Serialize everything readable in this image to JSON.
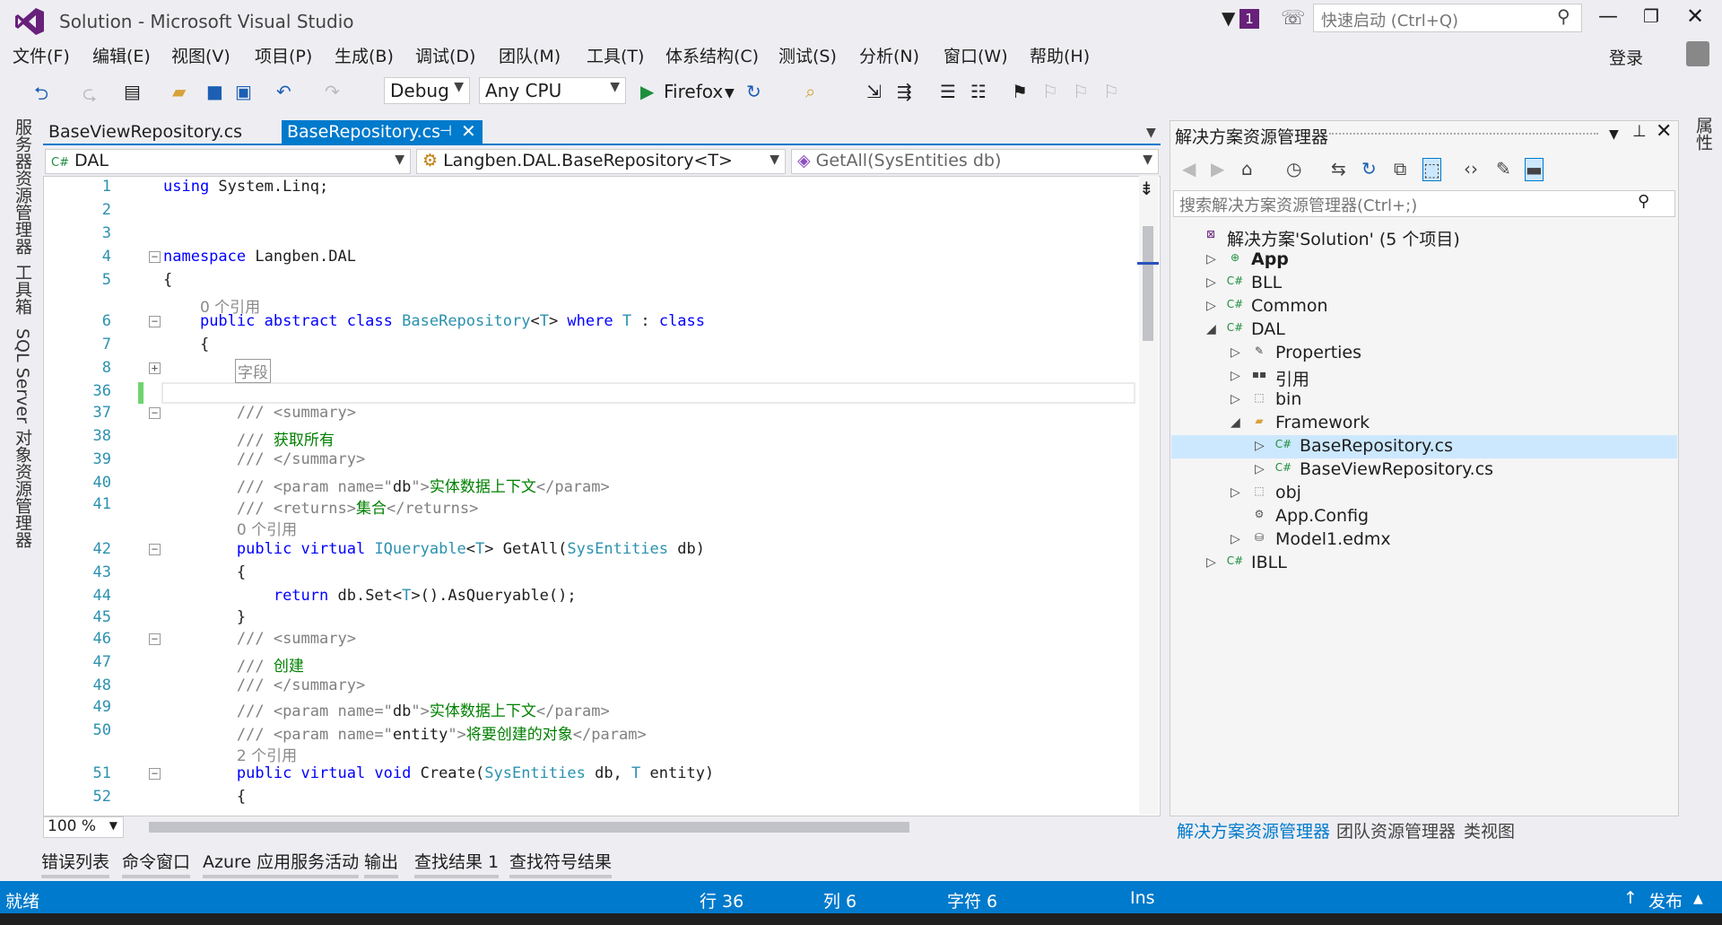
{
  "titlebar": {
    "title": "Solution - Microsoft Visual Studio",
    "notification_count": "1",
    "quick_launch_placeholder": "快速启动 (Ctrl+Q)"
  },
  "menu": [
    "文件(F)",
    "编辑(E)",
    "视图(V)",
    "项目(P)",
    "生成(B)",
    "调试(D)",
    "团队(M)",
    "工具(T)",
    "体系结构(C)",
    "测试(S)",
    "分析(N)",
    "窗口(W)",
    "帮助(H)"
  ],
  "signin": "登录",
  "toolbar": {
    "config": "Debug",
    "platform": "Any CPU",
    "run_target": "Firefox"
  },
  "left_vtabs": [
    "服务器资源管理器",
    "工具箱",
    "SQL Server 对象资源管理器"
  ],
  "doc_tabs": [
    {
      "label": "BaseViewRepository.cs"
    },
    {
      "label": "BaseRepository.cs"
    }
  ],
  "navbar": {
    "project": "DAL",
    "type": "Langben.DAL.BaseRepository<T>",
    "member": "GetAll(SysEntities db)"
  },
  "editor": {
    "zoom": "100 %",
    "collapsed_region": "字段",
    "lines": [
      {
        "n": "1",
        "html": "<span class='kw'>using</span> System.Linq;"
      },
      {
        "n": "2",
        "html": ""
      },
      {
        "n": "3",
        "html": ""
      },
      {
        "n": "4",
        "html": "<span class='kw'>namespace</span> Langben.DAL"
      },
      {
        "n": "5",
        "html": "{"
      },
      {
        "n": "",
        "html": "    <span class='ref'>0 个引用</span>"
      },
      {
        "n": "6",
        "html": "    <span class='kw'>public abstract class</span> <span class='ty'>BaseRepository</span>&lt;<span class='ty'>T</span>&gt; <span class='kw'>where</span> <span class='ty'>T</span> : <span class='kw'>class</span>"
      },
      {
        "n": "7",
        "html": "    {"
      },
      {
        "n": "8",
        "html": ""
      },
      {
        "n": "36",
        "html": ""
      },
      {
        "n": "37",
        "html": "        <span class='cg'>/// &lt;summary&gt;</span>"
      },
      {
        "n": "38",
        "html": "        <span class='cg'>///</span> <span class='cm'>获取所有</span>"
      },
      {
        "n": "39",
        "html": "        <span class='cg'>/// &lt;/summary&gt;</span>"
      },
      {
        "n": "40",
        "html": "        <span class='cg'>/// &lt;param name=\"</span>db<span class='cg'>\"&gt;</span><span class='cm'>实体数据上下文</span><span class='cg'>&lt;/param&gt;</span>"
      },
      {
        "n": "41",
        "html": "        <span class='cg'>/// &lt;returns&gt;</span><span class='cm'>集合</span><span class='cg'>&lt;/returns&gt;</span>"
      },
      {
        "n": "",
        "html": "        <span class='ref'>0 个引用</span>"
      },
      {
        "n": "42",
        "html": "        <span class='kw'>public virtual</span> <span class='ty'>IQueryable</span>&lt;<span class='ty'>T</span>&gt; GetAll(<span class='ty'>SysEntities</span> db)"
      },
      {
        "n": "43",
        "html": "        {"
      },
      {
        "n": "44",
        "html": "            <span class='kw'>return</span> db.Set&lt;<span class='ty'>T</span>&gt;().AsQueryable();"
      },
      {
        "n": "45",
        "html": "        }"
      },
      {
        "n": "46",
        "html": "        <span class='cg'>/// &lt;summary&gt;</span>"
      },
      {
        "n": "47",
        "html": "        <span class='cg'>///</span> <span class='cm'>创建</span>"
      },
      {
        "n": "48",
        "html": "        <span class='cg'>/// &lt;/summary&gt;</span>"
      },
      {
        "n": "49",
        "html": "        <span class='cg'>/// &lt;param name=\"</span>db<span class='cg'>\"&gt;</span><span class='cm'>实体数据上下文</span><span class='cg'>&lt;/param&gt;</span>"
      },
      {
        "n": "50",
        "html": "        <span class='cg'>/// &lt;param name=\"</span>entity<span class='cg'>\"&gt;</span><span class='cm'>将要创建的对象</span><span class='cg'>&lt;/param&gt;</span>"
      },
      {
        "n": "",
        "html": "        <span class='ref'>2 个引用</span>"
      },
      {
        "n": "51",
        "html": "        <span class='kw'>public virtual void</span> Create(<span class='ty'>SysEntities</span> db, <span class='ty'>T</span> entity)"
      },
      {
        "n": "52",
        "html": "        {"
      }
    ]
  },
  "solution_explorer": {
    "title": "解决方案资源管理器",
    "search_placeholder": "搜索解决方案资源管理器(Ctrl+;)",
    "tree": [
      {
        "label": "解决方案'Solution' (5 个项目)",
        "depth": 0,
        "arrow": "",
        "icon": "solution-icon",
        "bold": false
      },
      {
        "label": "App",
        "depth": 1,
        "arrow": "▷",
        "icon": "web-project-icon",
        "bold": true
      },
      {
        "label": "BLL",
        "depth": 1,
        "arrow": "▷",
        "icon": "csharp-project-icon",
        "bold": false
      },
      {
        "label": "Common",
        "depth": 1,
        "arrow": "▷",
        "icon": "csharp-project-icon",
        "bold": false
      },
      {
        "label": "DAL",
        "depth": 1,
        "arrow": "◢",
        "icon": "csharp-project-icon",
        "bold": false
      },
      {
        "label": "Properties",
        "depth": 2,
        "arrow": "▷",
        "icon": "wrench-icon",
        "bold": false
      },
      {
        "label": "引用",
        "depth": 2,
        "arrow": "▷",
        "icon": "references-icon",
        "bold": false
      },
      {
        "label": "bin",
        "depth": 2,
        "arrow": "▷",
        "icon": "folder-dotted-icon",
        "bold": false
      },
      {
        "label": "Framework",
        "depth": 2,
        "arrow": "◢",
        "icon": "folder-open-icon",
        "bold": false
      },
      {
        "label": "BaseRepository.cs",
        "depth": 3,
        "arrow": "▷",
        "icon": "csharp-file-icon",
        "bold": false
      },
      {
        "label": "BaseViewRepository.cs",
        "depth": 3,
        "arrow": "▷",
        "icon": "csharp-file-icon",
        "bold": false
      },
      {
        "label": "obj",
        "depth": 2,
        "arrow": "▷",
        "icon": "folder-dotted-icon",
        "bold": false
      },
      {
        "label": "App.Config",
        "depth": 2,
        "arrow": "",
        "icon": "config-file-icon",
        "bold": false
      },
      {
        "label": "Model1.edmx",
        "depth": 2,
        "arrow": "▷",
        "icon": "edmx-file-icon",
        "bold": false
      },
      {
        "label": "IBLL",
        "depth": 1,
        "arrow": "▷",
        "icon": "csharp-project-icon",
        "bold": false
      }
    ],
    "bottom_tabs": [
      "解决方案资源管理器",
      "团队资源管理器",
      "类视图"
    ]
  },
  "right_vtab": "属性",
  "bottom_tabs": [
    "错误列表",
    "命令窗口",
    "Azure 应用服务活动",
    "输出",
    "查找结果 1",
    "查找符号结果"
  ],
  "status": {
    "ready": "就绪",
    "line": "行 36",
    "col": "列 6",
    "ch": "字符 6",
    "mode": "Ins",
    "publish": "发布"
  },
  "colors": {
    "accent": "#007acc",
    "vs_purple": "#68217a"
  }
}
